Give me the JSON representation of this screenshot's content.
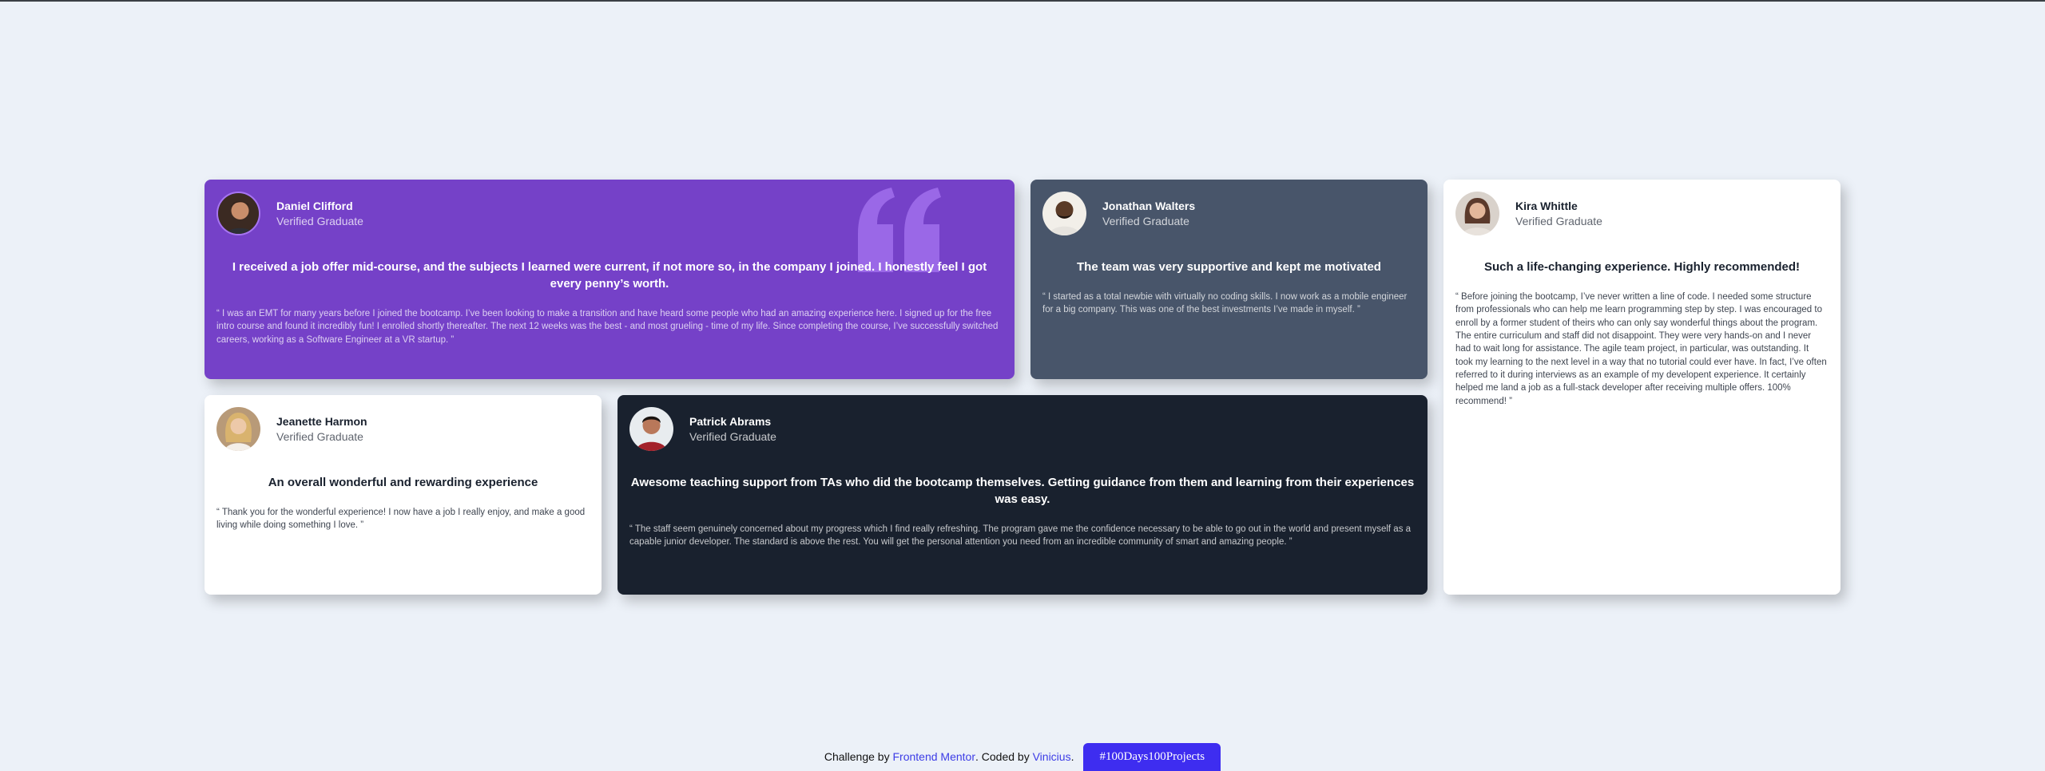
{
  "testimonials": [
    {
      "name": "Daniel Clifford",
      "status": "Verified Graduate",
      "headline": "I received a job offer mid-course, and the subjects I learned were current, if not more so, in the company I joined. I honestly feel I got every penny’s worth.",
      "body": "“ I was an EMT for many years before I joined the bootcamp. I’ve been looking to make a transition and have heard some people who had an amazing experience here. I signed up for the free intro course and found it incredibly fun! I enrolled shortly thereafter. The next 12 weeks was the best - and most grueling - time of my life. Since completing the course, I’ve successfully switched careers, working as a Software Engineer at a VR startup. ”",
      "bg": "#7541c8"
    },
    {
      "name": "Jonathan Walters",
      "status": "Verified Graduate",
      "headline": "The team was very supportive and kept me motivated",
      "body": "“ I started as a total newbie with virtually no coding skills. I now work as a mobile engineer for a big company. This was one of the best investments I’ve made in myself. ”",
      "bg": "#48556a"
    },
    {
      "name": "Kira Whittle",
      "status": "Verified Graduate",
      "headline": "Such a life-changing experience. Highly recommended!",
      "body": "“ Before joining the bootcamp, I’ve never written a line of code. I needed some structure from professionals who can help me learn programming step by step. I was encouraged to enroll by a former student of theirs who can only say wonderful things about the program. The entire curriculum and staff did not disappoint. They were very hands-on and I never had to wait long for assistance. The agile team project, in particular, was outstanding. It took my learning to the next level in a way that no tutorial could ever have. In fact, I’ve often referred to it during interviews as an example of my developent experience. It certainly helped me land a job as a full-stack developer after receiving multiple offers. 100% recommend! ”",
      "bg": "#ffffff"
    },
    {
      "name": "Jeanette Harmon",
      "status": "Verified Graduate",
      "headline": "An overall wonderful and rewarding experience",
      "body": "“ Thank you for the wonderful experience! I now have a job I really enjoy, and make a good living while doing something I love. ”",
      "bg": "#ffffff"
    },
    {
      "name": "Patrick Abrams",
      "status": "Verified Graduate",
      "headline": "Awesome teaching support from TAs who did the bootcamp themselves. Getting guidance from them and learning from their experiences was easy.",
      "body": "“ The staff seem genuinely concerned about my progress which I find really refreshing. The program gave me the confidence necessary to be able to go out in the world and present myself as a capable junior developer. The standard is above the rest. You will get the personal attention you need from an incredible community of smart and amazing people. ”",
      "bg": "#19212e"
    }
  ],
  "footer": {
    "challenge_by": "Challenge by",
    "frontend_mentor": "Frontend Mentor",
    "coded_by": ". Coded by",
    "author": "Vinicius",
    "period": ".",
    "badge": "#100Days100Projects"
  },
  "icons": {
    "quote": "quote-icon",
    "avatar": "avatar-photo"
  },
  "colors": {
    "page_bg": "#ecf1f8",
    "accent_link": "#3c3ce6",
    "badge_bg": "#3e2df0"
  }
}
